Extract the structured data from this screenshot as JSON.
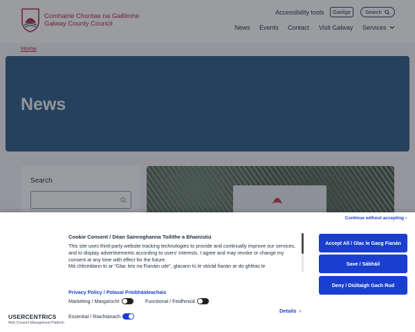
{
  "header": {
    "brand_irish": "Comhairle Chontae na Gaillimhe",
    "brand_english": "Galway County Council",
    "accessibility_label": "Accessibility tools",
    "language_label": "Gaeilge",
    "search_label": "Search",
    "nav": [
      "News",
      "Events",
      "Contact",
      "Visit Galway",
      "Services"
    ],
    "brand_color": "#b3243a"
  },
  "breadcrumb": {
    "home": "Home"
  },
  "hero": {
    "title": "News",
    "color": "#2b5985"
  },
  "sidebar": {
    "search_title": "Search",
    "search_placeholder": ""
  },
  "consent": {
    "continue_label": "Continue without accepting",
    "title": "Cookie Consent / Déan Sainroghanna Toilithe a Bhainistiú",
    "body_en": "This site uses third-party website tracking technologies to provide and continually improve our services, and to display advertisements according to users' interests. I agree and may revoke or change my consent at any time with effect for the future.",
    "body_ga": "Má chliceálann tú ar \"Glac leis na Fianáin uile\", glacann tú le stóráil fianán ar do ghléas le",
    "privacy_label": "Privacy Policy / Polasaí Príobháideachais",
    "toggles": [
      {
        "label": "Marketing / Margaíocht",
        "on": false
      },
      {
        "label": "Functional / Feidhmiúil",
        "on": false
      },
      {
        "label": "Essential / Riachtanach",
        "on": true
      }
    ],
    "details_label": "Details",
    "buttons": {
      "accept_all": "Accept All / Glac le Gacg Fianán",
      "save": "Save / Sábháil",
      "deny": "Deny / Diúltaigh Gach Rud"
    },
    "accent_color": "#1a3fcf",
    "vendor_name": "USERCENTRICS",
    "vendor_sub": "Web Consent Management Platform"
  }
}
